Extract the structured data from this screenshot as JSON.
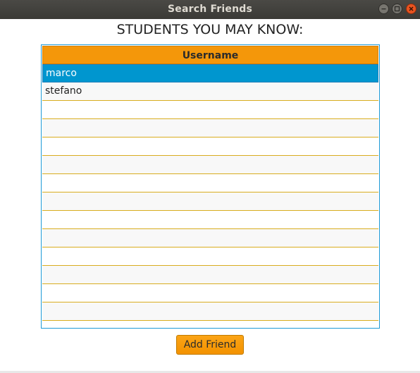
{
  "window": {
    "title": "Search Friends"
  },
  "heading": "STUDENTS YOU MAY KNOW:",
  "table": {
    "column_header": "Username",
    "rows": [
      "marco",
      "stefano",
      "",
      "",
      "",
      "",
      "",
      "",
      "",
      "",
      "",
      "",
      "",
      "",
      ""
    ],
    "selected_index": 0
  },
  "actions": {
    "add_friend_label": "Add Friend"
  },
  "icons": {
    "minimize": "minimize-icon",
    "maximize": "maximize-icon",
    "close": "close-icon"
  },
  "colors": {
    "accent": "#f4970a",
    "selection": "#0096cf",
    "close": "#e95420"
  }
}
